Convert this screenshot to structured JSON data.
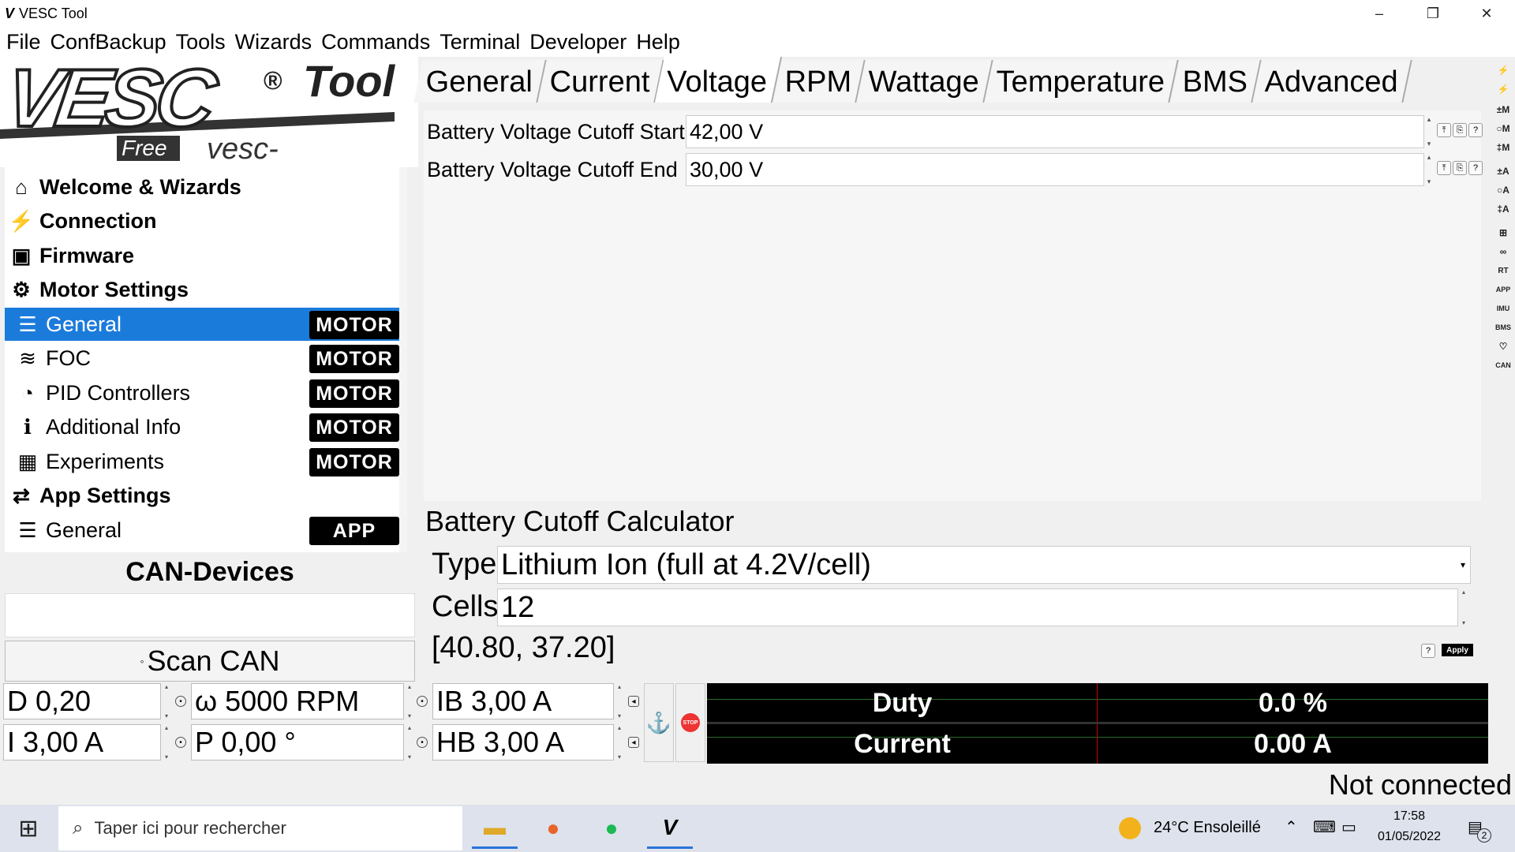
{
  "window": {
    "title": "VESC Tool",
    "minimize": "–",
    "restore": "❐",
    "close": "✕"
  },
  "menu": [
    "File",
    "ConfBackup",
    "Tools",
    "Wizards",
    "Commands",
    "Terminal",
    "Developer",
    "Help"
  ],
  "logo": {
    "main": "VESC",
    "tool": "Tool",
    "free": "Free",
    "url": "vesc-project.com",
    "reg": "®"
  },
  "tabs": [
    {
      "label": "General",
      "active": false
    },
    {
      "label": "Current",
      "active": false
    },
    {
      "label": "Voltage",
      "active": true
    },
    {
      "label": "RPM",
      "active": false
    },
    {
      "label": "Wattage",
      "active": false
    },
    {
      "label": "Temperature",
      "active": false
    },
    {
      "label": "BMS",
      "active": false
    },
    {
      "label": "Advanced",
      "active": false
    }
  ],
  "settings": [
    {
      "label": "Battery Voltage Cutoff Start",
      "value": "42,00 V"
    },
    {
      "label": "Battery Voltage Cutoff End",
      "value": "30,00 V"
    }
  ],
  "calculator": {
    "title": "Battery Cutoff Calculator",
    "type_label": "Type",
    "type_value": "Lithium Ion (full at 4.2V/cell)",
    "cells_label": "Cells",
    "cells_value": "12",
    "result": "[40.80, 37.20]",
    "apply_label": "Apply"
  },
  "nav": [
    {
      "label": "Welcome & Wizards",
      "icon": "home-icon",
      "glyph": "⌂",
      "level": "top",
      "badge": ""
    },
    {
      "label": "Connection",
      "icon": "plug-icon",
      "glyph": "⚡",
      "level": "top",
      "badge": ""
    },
    {
      "label": "Firmware",
      "icon": "chip-icon",
      "glyph": "▣",
      "level": "top",
      "badge": ""
    },
    {
      "label": "Motor Settings",
      "icon": "motor-icon",
      "glyph": "⚙",
      "level": "top",
      "badge": ""
    },
    {
      "label": "General",
      "icon": "sliders-icon",
      "glyph": "☰",
      "level": "sub",
      "badge": "MOTOR",
      "selected": true
    },
    {
      "label": "FOC",
      "icon": "waveform-icon",
      "glyph": "≋",
      "level": "sub",
      "badge": "MOTOR"
    },
    {
      "label": "PID Controllers",
      "icon": "gauge-icon",
      "glyph": "◔",
      "level": "sub",
      "badge": "MOTOR"
    },
    {
      "label": "Additional Info",
      "icon": "info-icon",
      "glyph": "ℹ",
      "level": "sub",
      "badge": "MOTOR"
    },
    {
      "label": "Experiments",
      "icon": "calculator-icon",
      "glyph": "▦",
      "level": "sub",
      "badge": "MOTOR"
    },
    {
      "label": "App Settings",
      "icon": "app-icon",
      "glyph": "⇄",
      "level": "top",
      "badge": ""
    },
    {
      "label": "General",
      "icon": "sliders-icon",
      "glyph": "☰",
      "level": "sub",
      "badge": "APP"
    }
  ],
  "can": {
    "title": "CAN-Devices",
    "scan_label": "Scan CAN",
    "scan_glyph": "◦"
  },
  "bottom": {
    "duty": "D 0,20",
    "current": "I 3,00 A",
    "rpm": "ω 5000 RPM",
    "position": "P 0,00 °",
    "brake": "IB 3,00 A",
    "handbrake": "HB 3,00 A",
    "anchor_glyph": "⚓",
    "stop_label": "STOP"
  },
  "meter": [
    {
      "label": "Duty",
      "value": "0.0 %"
    },
    {
      "label": "Current",
      "value": "0.00 A"
    }
  ],
  "status": "Not connected",
  "right_toolbar": [
    "⚡",
    "⚡",
    "±M",
    "○M",
    "‡M",
    "±A",
    "○A",
    "‡A",
    "⊞",
    "∞",
    "RT",
    "APP",
    "IMU",
    "BMS",
    "♡",
    "CAN"
  ],
  "taskbar": {
    "start_glyph": "⊞",
    "search_placeholder": "Taper ici pour rechercher",
    "weather": "24°C  Ensoleillé",
    "time": "17:58",
    "date": "01/05/2022",
    "notif_count": "2"
  },
  "colors": {
    "accent": "#1b7bdb",
    "meter_bg": "#000000",
    "badge_bg": "#000000"
  }
}
